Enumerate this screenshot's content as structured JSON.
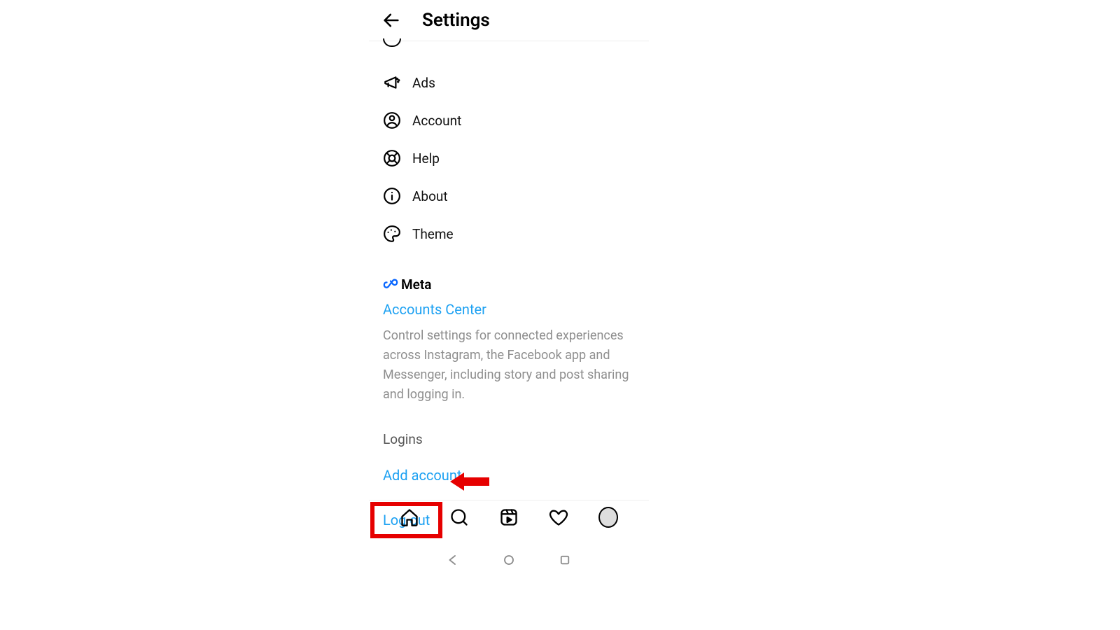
{
  "header": {
    "title": "Settings"
  },
  "settings": {
    "ads": "Ads",
    "account": "Account",
    "help": "Help",
    "about": "About",
    "theme": "Theme"
  },
  "meta": {
    "brand": "Meta",
    "accounts_center": "Accounts Center",
    "description": "Control settings for connected experiences across Instagram, the Facebook app and Messenger, including story and post sharing and logging in."
  },
  "logins": {
    "title": "Logins",
    "add_account": "Add account",
    "logout": "Log out"
  }
}
